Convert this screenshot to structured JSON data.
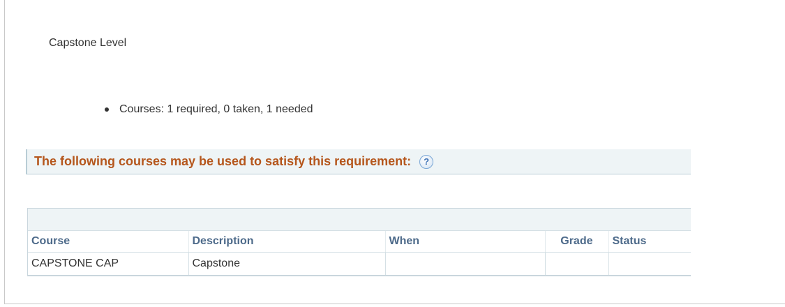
{
  "level": {
    "title": "Capstone Level"
  },
  "requirements": [
    {
      "text": "Courses: 1 required, 0 taken, 1 needed"
    }
  ],
  "satisfy": {
    "text": "The following courses may be used to satisfy this requirement:",
    "help_icon": "question-mark-icon",
    "help_glyph": "?"
  },
  "table": {
    "headers": {
      "course": "Course",
      "description": "Description",
      "when": "When",
      "grade": "Grade",
      "status": "Status"
    },
    "rows": [
      {
        "course": "CAPSTONE CAP",
        "description": "Capstone",
        "when": "",
        "grade": "",
        "status": ""
      }
    ]
  },
  "colors": {
    "heading_orange": "#b5561c",
    "header_blue": "#4d6a8a",
    "bar_background": "#eef4f6"
  }
}
